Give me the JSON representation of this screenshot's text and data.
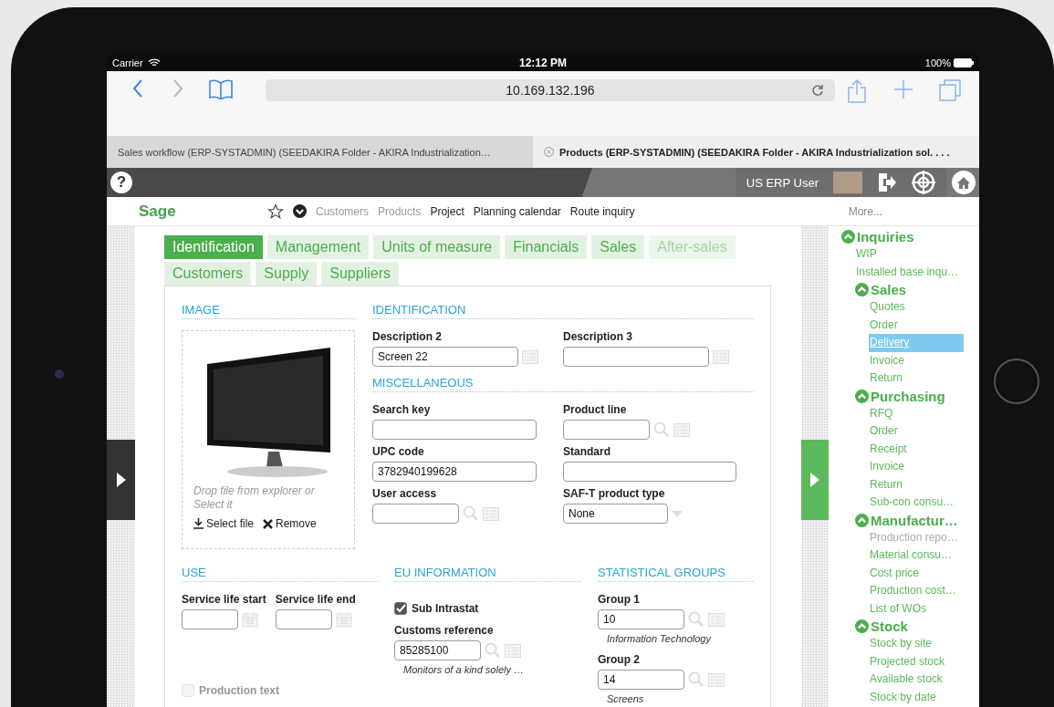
{
  "status_bar": {
    "carrier": "Carrier",
    "time": "12:12 PM",
    "battery": "100%"
  },
  "browser": {
    "url": "10.169.132.196",
    "tabs": [
      {
        "label": "Sales workflow (ERP-SYSTADMIN) (SEEDAKIRA Folder -   AKIRA Industrialization…",
        "selected": false
      },
      {
        "label": "Products (ERP-SYSTADMIN) (SEEDAKIRA Folder - AKIRA Industrialization sol. . . .",
        "selected": true
      }
    ]
  },
  "app_header": {
    "help": "?",
    "user": "US ERP User"
  },
  "nav": {
    "logo": "Sage",
    "items": [
      {
        "label": "Customers",
        "disabled": true
      },
      {
        "label": "Products",
        "disabled": true
      },
      {
        "label": "Project",
        "disabled": false
      },
      {
        "label": "Planning calendar",
        "disabled": false
      },
      {
        "label": "Route inquiry",
        "disabled": false
      }
    ],
    "more": "More..."
  },
  "form_tabs": [
    {
      "label": "Identification",
      "selected": true,
      "disabled": false
    },
    {
      "label": "Management",
      "selected": false,
      "disabled": false
    },
    {
      "label": "Units of measure",
      "selected": false,
      "disabled": false
    },
    {
      "label": "Financials",
      "selected": false,
      "disabled": false
    },
    {
      "label": "Sales",
      "selected": false,
      "disabled": false
    },
    {
      "label": "After-sales",
      "selected": false,
      "disabled": true
    },
    {
      "label": "Customers",
      "selected": false,
      "disabled": false
    },
    {
      "label": "Supply",
      "selected": false,
      "disabled": false
    },
    {
      "label": "Suppliers",
      "selected": false,
      "disabled": false
    }
  ],
  "image_section": {
    "title": "IMAGE",
    "hint": "Drop file from explorer or Select it",
    "select_file": "Select file",
    "remove": "Remove"
  },
  "identification": {
    "title": "IDENTIFICATION",
    "fields": [
      {
        "kind": "translatable",
        "label": "Description 2",
        "value": "Screen 22"
      },
      {
        "kind": "translatable",
        "label": "Description 3"
      }
    ]
  },
  "miscellaneous": {
    "title": "MISCELLANEOUS",
    "fields": [
      {
        "kind": "text",
        "label": "Search key"
      },
      {
        "kind": "lookup",
        "label": "Product line"
      },
      {
        "kind": "text",
        "label": "UPC code",
        "value": "3782940199628"
      },
      {
        "kind": "wide",
        "label": "Standard"
      },
      {
        "kind": "lookup",
        "label": "User access"
      },
      {
        "kind": "select",
        "label": "SAF-T product type",
        "value": "None"
      }
    ]
  },
  "lower_sections": [
    {
      "title": "USE",
      "fields": [
        {
          "kind": "date",
          "label": "Service life start"
        },
        {
          "kind": "date",
          "label": "Service life end"
        },
        {
          "kind": "check",
          "label": "Production text",
          "checked": false,
          "disabled": true
        }
      ]
    },
    {
      "title": "EU INFORMATION",
      "fields": [
        {
          "kind": "check",
          "label": "Sub Intrastat",
          "checked": true,
          "disabled": false
        },
        {
          "kind": "lookup",
          "label": "Customs reference",
          "value": "85285100",
          "note": "Monitors of a kind solely …"
        }
      ]
    },
    {
      "title": "STATISTICAL GROUPS",
      "fields": [
        {
          "kind": "lookup",
          "label": "Group 1",
          "value": "10",
          "note": "Information Technology"
        },
        {
          "kind": "lookup",
          "label": "Group 2",
          "value": "14",
          "note": "Screens"
        }
      ]
    }
  ],
  "sidebar": {
    "items": [
      {
        "label": "Inquiries",
        "expanded": true,
        "children": [
          {
            "label": "WIP",
            "disabled": false,
            "selected": false
          },
          {
            "label": "Installed base inqu…",
            "disabled": false,
            "selected": false
          },
          {
            "label": "Sales",
            "expanded": true,
            "children": [
              {
                "label": "Quotes",
                "disabled": false,
                "selected": false
              },
              {
                "label": "Order",
                "disabled": false,
                "selected": false
              },
              {
                "label": "Delivery",
                "disabled": false,
                "selected": true
              },
              {
                "label": "Invoice",
                "disabled": false,
                "selected": false
              },
              {
                "label": "Return",
                "disabled": false,
                "selected": false
              }
            ]
          },
          {
            "label": "Purchasing",
            "expanded": true,
            "children": [
              {
                "label": "RFQ",
                "disabled": false,
                "selected": false
              },
              {
                "label": "Order",
                "disabled": false,
                "selected": false
              },
              {
                "label": "Receipt",
                "disabled": false,
                "selected": false
              },
              {
                "label": "Invoice",
                "disabled": false,
                "selected": false
              },
              {
                "label": "Return",
                "disabled": false,
                "selected": false
              },
              {
                "label": "Sub-con consu…",
                "disabled": false,
                "selected": false
              }
            ]
          },
          {
            "label": "Manufactur…",
            "expanded": true,
            "children": [
              {
                "label": "Production repo…",
                "disabled": true,
                "selected": false
              },
              {
                "label": "Material consu…",
                "disabled": false,
                "selected": false
              },
              {
                "label": "Cost price",
                "disabled": false,
                "selected": false
              },
              {
                "label": "Production cost…",
                "disabled": false,
                "selected": false
              },
              {
                "label": "List of WOs",
                "disabled": false,
                "selected": false
              }
            ]
          },
          {
            "label": "Stock",
            "expanded": true,
            "children": [
              {
                "label": "Stock by site",
                "disabled": false,
                "selected": false
              },
              {
                "label": "Projected stock",
                "disabled": false,
                "selected": false
              },
              {
                "label": "Available stock",
                "disabled": false,
                "selected": false
              },
              {
                "label": "Stock by date",
                "disabled": false,
                "selected": false
              }
            ]
          }
        ]
      }
    ]
  }
}
